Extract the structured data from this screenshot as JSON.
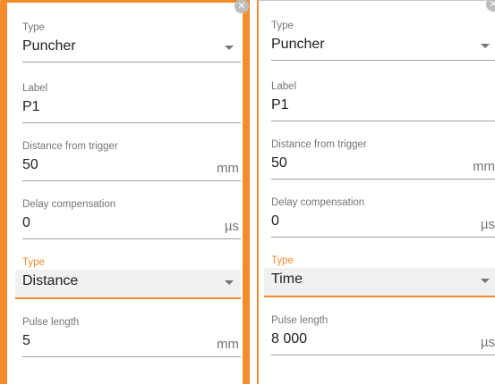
{
  "panels": [
    {
      "fields": [
        {
          "label": "Type",
          "value": "Puncher",
          "kind": "select"
        },
        {
          "label": "Label",
          "value": "P1",
          "kind": "text"
        },
        {
          "label": "Distance from trigger",
          "value": "50",
          "unit": "mm",
          "kind": "number"
        },
        {
          "label": "Delay compensation",
          "value": "0",
          "unit": "µs",
          "kind": "number"
        },
        {
          "label": "Type",
          "value": "Distance",
          "kind": "select",
          "focused": true
        },
        {
          "label": "Pulse length",
          "value": "5",
          "unit": "mm",
          "kind": "number"
        }
      ]
    },
    {
      "fields": [
        {
          "label": "Type",
          "value": "Puncher",
          "kind": "select"
        },
        {
          "label": "Label",
          "value": "P1",
          "kind": "text"
        },
        {
          "label": "Distance from trigger",
          "value": "50",
          "unit": "mm",
          "kind": "number"
        },
        {
          "label": "Delay compensation",
          "value": "0",
          "unit": "µs",
          "kind": "number"
        },
        {
          "label": "Type",
          "value": "Time",
          "kind": "select",
          "focused": true
        },
        {
          "label": "Pulse length",
          "value": "8 000",
          "unit": "µs",
          "kind": "number"
        }
      ]
    }
  ],
  "icons": {
    "close": "close-icon",
    "dropdown": "chevron-down-icon"
  },
  "colors": {
    "accent": "#f68b2c",
    "label": "#757575",
    "text": "#212121",
    "underline": "#9e9e9e"
  }
}
